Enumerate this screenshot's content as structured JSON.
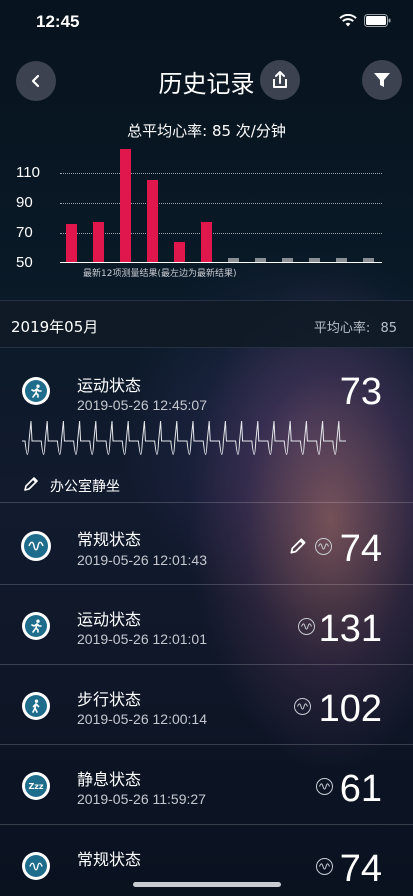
{
  "status_bar": {
    "time": "12:45"
  },
  "header": {
    "title": "历史记录"
  },
  "summary": {
    "avg_text": "总平均心率: 85 次/分钟"
  },
  "chart_data": {
    "type": "bar",
    "title": "总平均心率: 85 次/分钟",
    "caption": "最新12项测量结果(最左边为最新结果)",
    "y_ticks": [
      "110",
      "90",
      "70",
      "50"
    ],
    "ylim": [
      50,
      110
    ],
    "values": [
      73,
      74,
      123,
      102,
      61,
      74,
      null,
      null,
      null,
      null,
      null,
      null
    ],
    "colors": {
      "measured": "#e0174c",
      "empty": "#8a8e95"
    },
    "grid": true
  },
  "month": {
    "label": "2019年05月",
    "avg_label": "平均心率:",
    "avg_value": "85"
  },
  "records": [
    {
      "state": "运动状态",
      "time": "2019-05-26 12:45:07",
      "bpm": "73",
      "note": "办公室静坐",
      "icon": "running-icon"
    },
    {
      "state": "常规状态",
      "time": "2019-05-26 12:01:43",
      "bpm": "74",
      "icon": "wave-icon"
    },
    {
      "state": "运动状态",
      "time": "2019-05-26 12:01:01",
      "bpm": "131",
      "icon": "running-icon"
    },
    {
      "state": "步行状态",
      "time": "2019-05-26 12:00:14",
      "bpm": "102",
      "icon": "walking-icon"
    },
    {
      "state": "静息状态",
      "time": "2019-05-26 11:59:27",
      "bpm": "61",
      "icon": "sleep-icon",
      "icon_text": "Zzz"
    },
    {
      "state": "常规状态",
      "bpm": "74",
      "icon": "wave-icon"
    }
  ]
}
